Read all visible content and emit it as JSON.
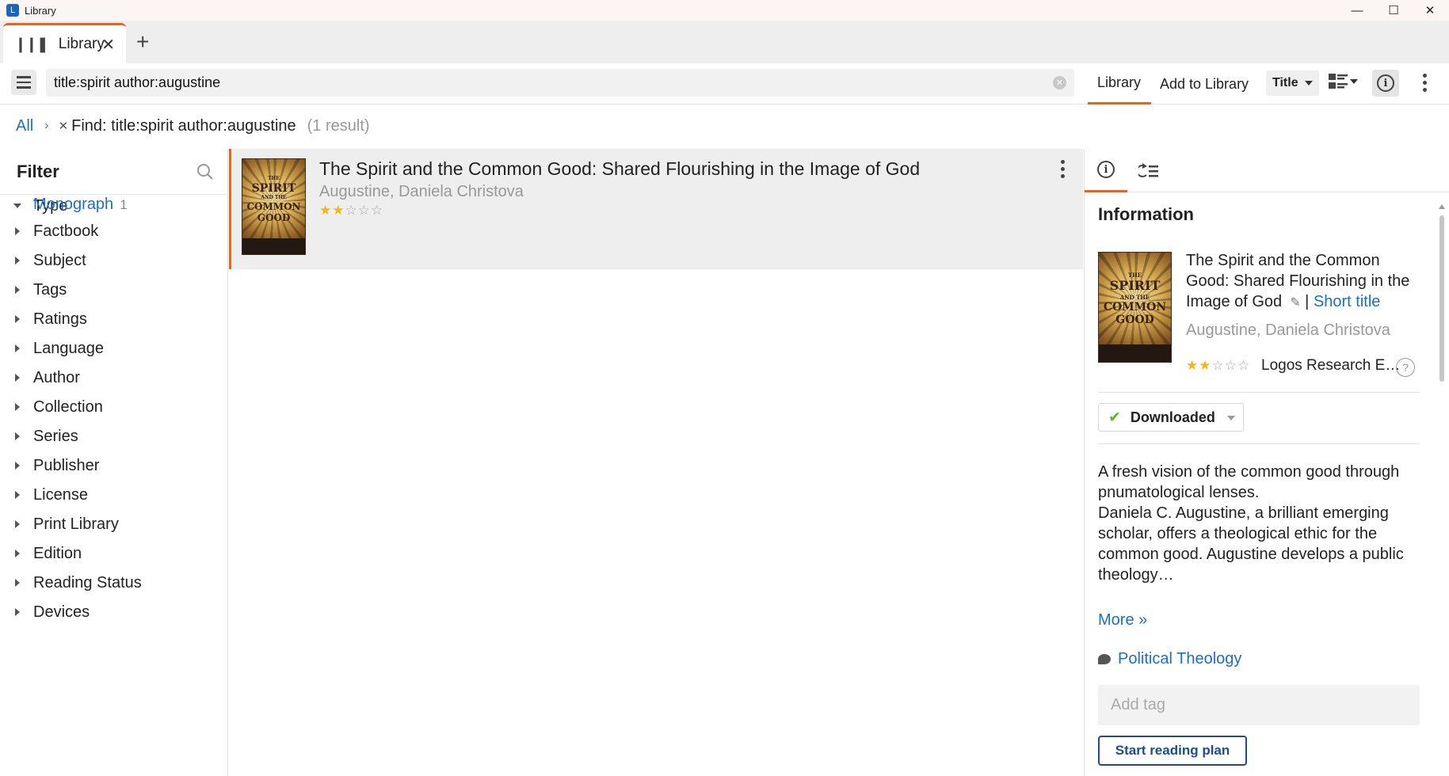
{
  "window": {
    "title": "Library",
    "app_icon": "logos-app-icon",
    "controls": [
      "minimize-icon",
      "maximize-icon",
      "close-icon"
    ]
  },
  "tabs": [
    {
      "label": "Library",
      "icon": "library-books-icon",
      "active": true
    }
  ],
  "toolbar": {
    "search_value": "title:spirit author:augustine",
    "library_label": "Library",
    "add_label": "Add to Library",
    "sort_label": "Title"
  },
  "breadcrumb": {
    "root": "All",
    "find": "Find: title:spirit author:augustine",
    "count": "(1 result)"
  },
  "filter": {
    "title": "Filter",
    "expanded": {
      "label": "Type",
      "items": [
        {
          "label": "Monograph",
          "count": "1"
        }
      ]
    },
    "groups": [
      "Factbook",
      "Subject",
      "Tags",
      "Ratings",
      "Language",
      "Author",
      "Collection",
      "Series",
      "Publisher",
      "License",
      "Print Library",
      "Edition",
      "Reading Status",
      "Devices"
    ]
  },
  "results": [
    {
      "title": "The Spirit and the Common Good: Shared Flourishing in the Image of God",
      "author": "Augustine, Daniela Christova",
      "rating": 2,
      "rating_max": 5,
      "cover": {
        "line1": "THE",
        "line2": "SPIRIT",
        "line3": "AND THE",
        "line4": "COMMON",
        "line5": "GOOD"
      }
    }
  ],
  "info": {
    "heading": "Information",
    "title": "The Spirit and the Common Good: Shared Flourishing in the Image of God",
    "short_title_link": "Short title",
    "author": "Augustine, Daniela Christova",
    "rating": 2,
    "research_label": "Logos Research E…",
    "help": "?",
    "status": "Downloaded",
    "description_1": "A fresh vision of the common good through pnumatological lenses.",
    "description_2": "Daniela C. Augustine, a brilliant emerging scholar, offers a theological ethic for the common good. Augustine develops a public theology…",
    "more": "More »",
    "subject": "Political Theology",
    "tag_placeholder": "Add tag",
    "plan_button": "Start reading plan"
  },
  "colors": {
    "accent": "#e8661c",
    "link": "#1c6fc2",
    "star_on": "#f2b618",
    "check": "#5cb82a"
  }
}
